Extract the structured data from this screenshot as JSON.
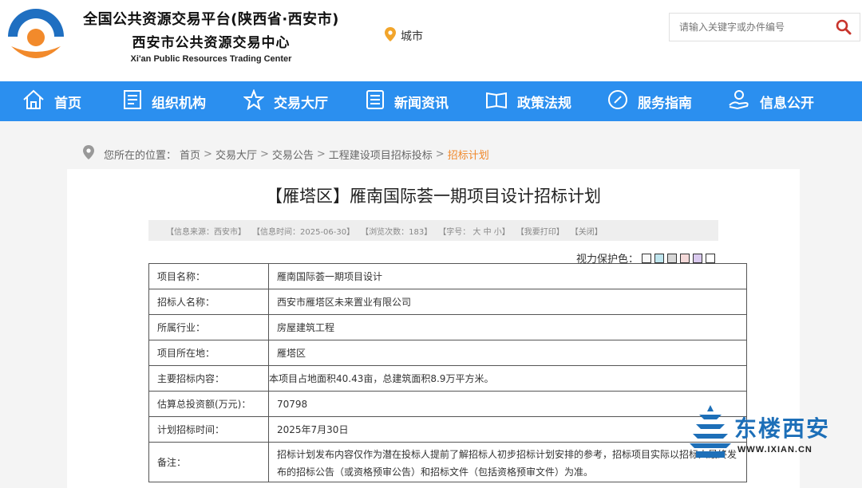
{
  "header": {
    "title_line1": "全国公共资源交易平台(陕西省·西安市)",
    "title_line2": "西安市公共资源交易中心",
    "title_line3": "Xi'an Public Resources Trading Center",
    "city_label": "城市",
    "search_placeholder": "请输入关键字或办件编号",
    "logo_colors": {
      "blue": "#1f6fc1",
      "orange": "#f28a2b"
    }
  },
  "nav": [
    {
      "label": "首页",
      "icon": "home-icon"
    },
    {
      "label": "组织机构",
      "icon": "document-icon"
    },
    {
      "label": "交易大厅",
      "icon": "star-icon"
    },
    {
      "label": "新闻资讯",
      "icon": "list-icon"
    },
    {
      "label": "政策法规",
      "icon": "book-icon"
    },
    {
      "label": "服务指南",
      "icon": "compass-icon"
    },
    {
      "label": "信息公开",
      "icon": "hand-icon"
    }
  ],
  "breadcrumb": {
    "prefix": "您所在的位置：",
    "items": [
      "首页",
      "交易大厅",
      "交易公告",
      "工程建设项目招标投标"
    ],
    "separator": ">",
    "current": "招标计划"
  },
  "article": {
    "title": "【雁塔区】雁南国际荟一期项目设计招标计划",
    "info": {
      "source": "【信息来源：西安市】",
      "time": "【信息时间：2025-06-30】",
      "views": "【浏览次数：183】",
      "font_prefix": "【字号：",
      "font_large": "大",
      "font_medium": "中",
      "font_small": "小】",
      "print": "【我要打印】",
      "close": "【关闭】"
    },
    "eye_label": "视力保护色：",
    "eye_colors": [
      "#f8f8f8",
      "#bfe6ef",
      "#d7d7d7",
      "#f4d9d9",
      "#d9c9ee",
      "#ffffff"
    ],
    "rows": [
      {
        "key": "项目名称：",
        "value": "雁南国际荟一期项目设计"
      },
      {
        "key": "招标人名称：",
        "value": "西安市雁塔区未来置业有限公司"
      },
      {
        "key": "所属行业：",
        "value": "房屋建筑工程"
      },
      {
        "key": "项目所在地：",
        "value": "雁塔区"
      },
      {
        "key": "主要招标内容：",
        "value": "本项目占地面积40.43亩，总建筑面积8.9万平方米。"
      },
      {
        "key": "估算总投资额(万元)：",
        "value": "70798"
      },
      {
        "key": "计划招标时间：",
        "value": "2025年7月30日"
      },
      {
        "key": "备注：",
        "value": "招标计划发布内容仅作为潜在投标人提前了解招标人初步招标计划安排的参考，招标项目实际以招标人最终发布的招标公告（或资格预审公告）和招标文件（包括资格预审文件）为准。"
      }
    ]
  },
  "watermark": {
    "text": "东楼西安",
    "url": "WWW.IXIAN.CN",
    "color": "#1d6fb8"
  }
}
